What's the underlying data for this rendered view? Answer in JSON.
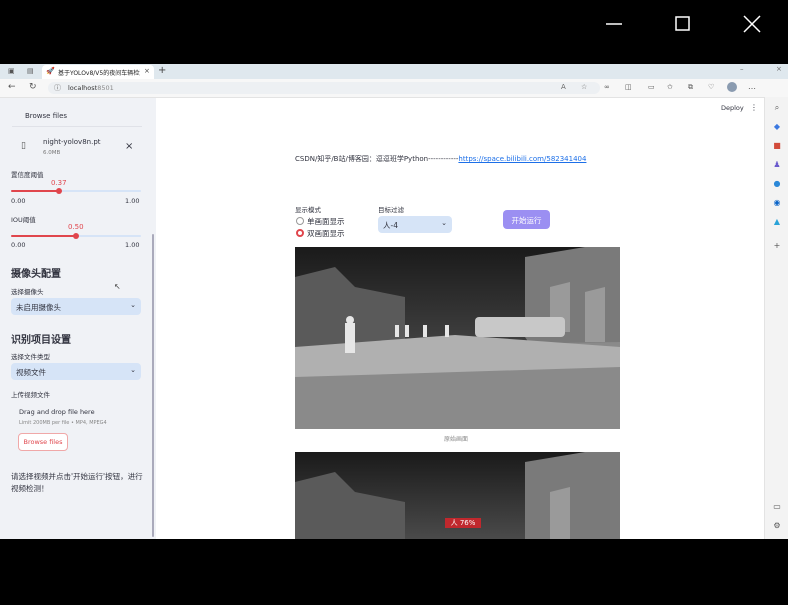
{
  "browser": {
    "tab_title": "基于YOLOv8/V5的夜间车辆检测",
    "url_host": "localhost",
    "url_port": ":8501"
  },
  "header": {
    "deploy_label": "Deploy",
    "menu_glyph": "⋮"
  },
  "sidebar": {
    "browse_label": "Browse files",
    "model_file": {
      "name": "night-yolov8n.pt",
      "size": "6.0MB"
    },
    "confidence": {
      "label": "置信度阈值",
      "value_text": "0.37",
      "min": "0.00",
      "max": "1.00",
      "value": 0.37
    },
    "iou": {
      "label": "IOU阈值",
      "value_text": "0.50",
      "min": "0.00",
      "max": "1.00",
      "value": 0.5
    },
    "camera_section": "摄像头配置",
    "camera_label": "选择摄像头",
    "camera_value": "未启用摄像头",
    "recog_section": "识别项目设置",
    "file_type_label": "选择文件类型",
    "file_type_value": "视频文件",
    "upload_label": "上传视频文件",
    "drag_text": "Drag and drop file here",
    "limit_text": "Limit 200MB per file • MP4, MPEG4",
    "upload_browse": "Browse files",
    "hint": "请选择视频并点击'开始运行'按钮，进行视频检测！"
  },
  "main": {
    "csdn_text": "CSDN/知乎/B站/博客园：逗逗班学Python------------",
    "link": "https://space.bilibili.com/582341404",
    "mode_label": "显示模式",
    "modes": [
      "单画面显示",
      "双画面显示"
    ],
    "selected_mode": "双画面显示",
    "target_label": "目标过滤",
    "target_value": "人-4",
    "run_button": "开始运行",
    "caption_original": "原始画面",
    "detection_label": "人 76%"
  },
  "colors": {
    "accent": "#ff4b4b",
    "link": "#1c6fe8",
    "sidebar": "#f0f2f6",
    "select": "#d6e4f7",
    "run": "#9b8ff2"
  }
}
